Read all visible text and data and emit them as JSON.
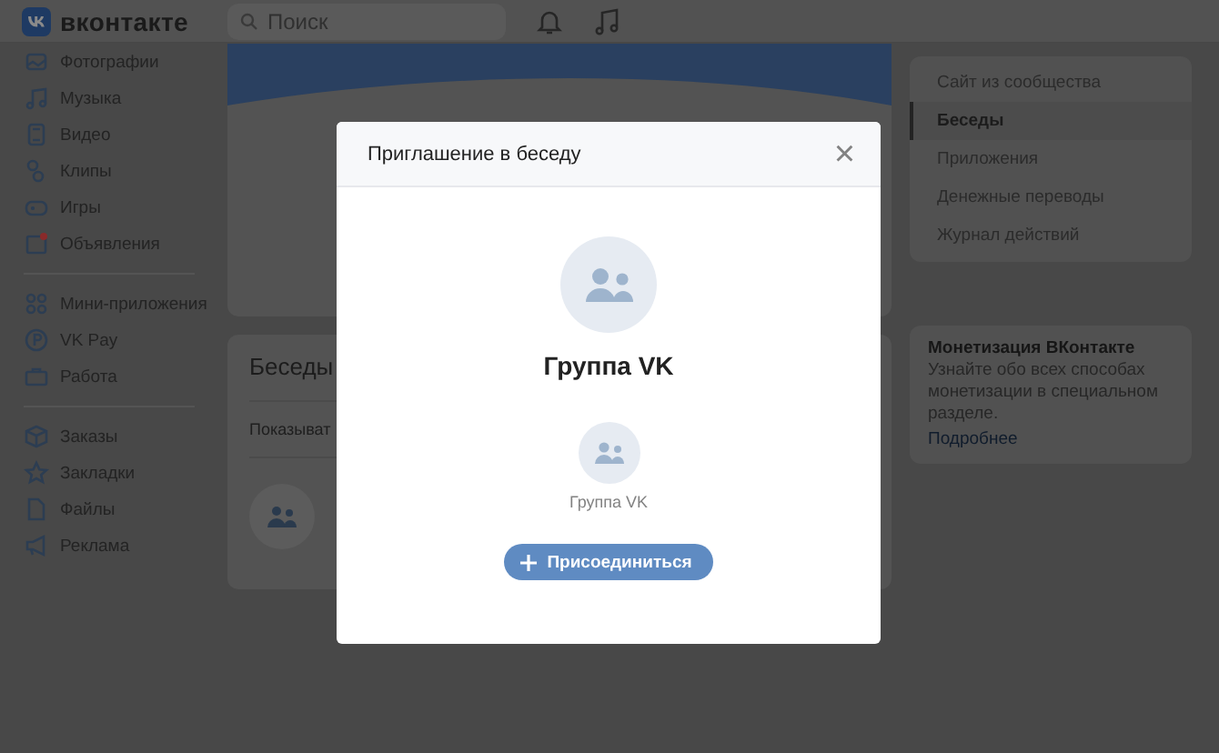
{
  "header": {
    "logo_text": "вконтакте",
    "search": {
      "placeholder": "Поиск"
    }
  },
  "sidebar": {
    "groups": [
      [
        {
          "kind": "photo",
          "label": "Фотографии"
        },
        {
          "kind": "music",
          "label": "Музыка"
        },
        {
          "kind": "video",
          "label": "Видео"
        },
        {
          "kind": "clips",
          "label": "Клипы"
        },
        {
          "kind": "games",
          "label": "Игры"
        },
        {
          "kind": "ads",
          "label": "Объявления"
        }
      ],
      [
        {
          "kind": "apps",
          "label": "Мини-приложения"
        },
        {
          "kind": "pay",
          "label": "VK Pay"
        },
        {
          "kind": "work",
          "label": "Работа"
        }
      ],
      [
        {
          "kind": "orders",
          "label": "Заказы"
        },
        {
          "kind": "bookmarks",
          "label": "Закладки"
        },
        {
          "kind": "files",
          "label": "Файлы"
        },
        {
          "kind": "promo",
          "label": "Реклама"
        }
      ]
    ]
  },
  "chats_card": {
    "title": "Беседы",
    "filter_text": "Показыват"
  },
  "right_menu": {
    "items": [
      {
        "label": "Сайт из сообщества",
        "selected": false
      },
      {
        "label": "Беседы",
        "selected": true
      },
      {
        "label": "Приложения",
        "selected": false
      },
      {
        "label": "Денежные переводы",
        "selected": false
      },
      {
        "label": "Журнал действий",
        "selected": false
      }
    ]
  },
  "promo_card": {
    "title": "Монетизация ВКонтакте",
    "text": "Узнайте обо всех способах монетизации в специальном разделе.",
    "link": "Подробнее"
  },
  "modal": {
    "title": "Приглашение в беседу",
    "close": "×",
    "chat_name": "Группа VK",
    "member_name": "Группа VK",
    "join_button": "Присоединиться"
  }
}
